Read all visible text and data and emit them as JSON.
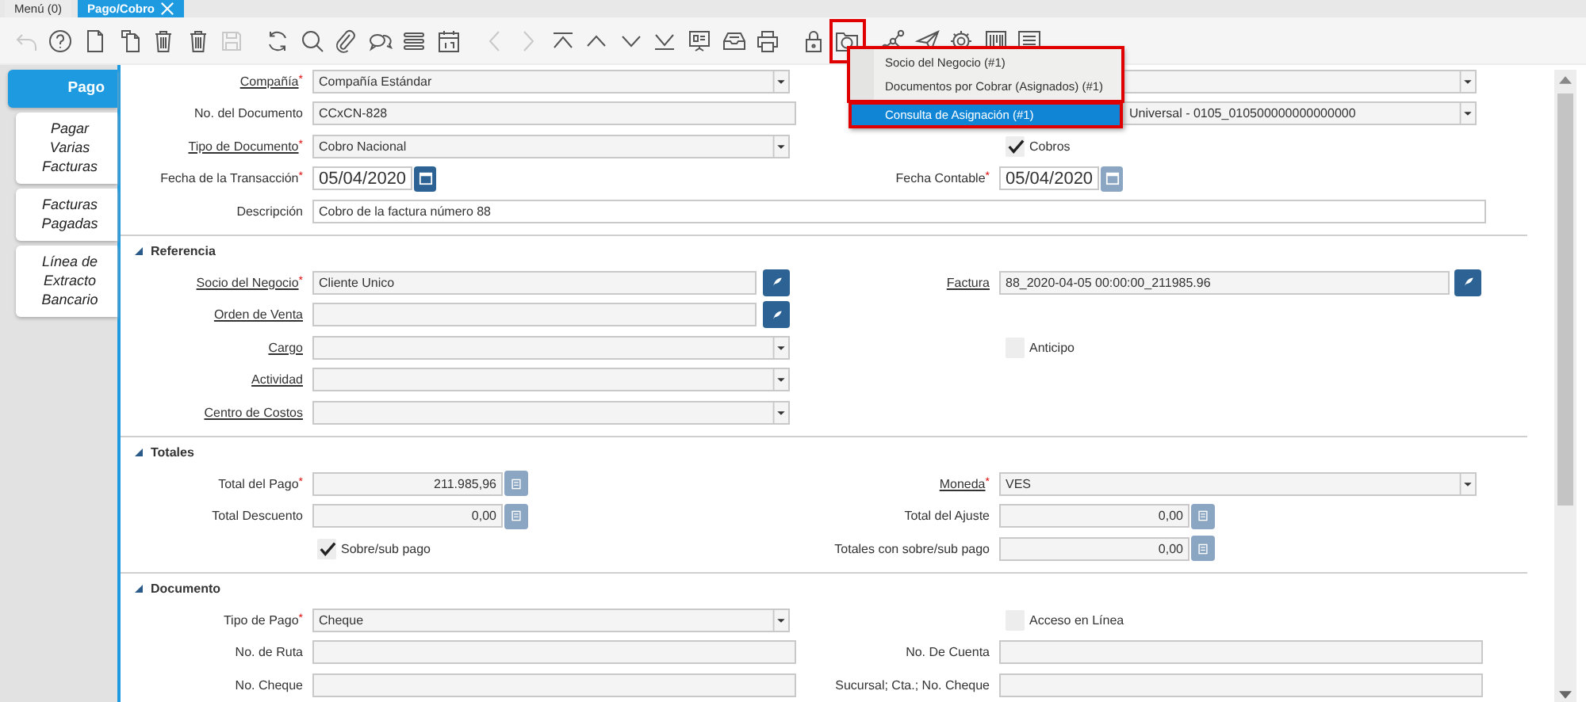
{
  "tabs": [
    {
      "label": "Menú (0)",
      "selected": false,
      "closable": false
    },
    {
      "label": "Pago/Cobro",
      "selected": true,
      "closable": true
    }
  ],
  "toolbar": [
    {
      "kind": "undo",
      "disabled": true,
      "highlighted": false
    },
    {
      "kind": "help",
      "disabled": false,
      "highlighted": false
    },
    {
      "kind": "new",
      "disabled": false,
      "highlighted": false
    },
    {
      "kind": "copy",
      "disabled": false,
      "highlighted": false
    },
    {
      "kind": "delete",
      "disabled": false,
      "highlighted": false
    },
    {
      "kind": "delete",
      "disabled": false,
      "highlighted": false
    },
    {
      "kind": "save",
      "disabled": true,
      "highlighted": false
    },
    {
      "kind": "refresh",
      "disabled": false,
      "highlighted": false
    },
    {
      "kind": "search",
      "disabled": false,
      "highlighted": false
    },
    {
      "kind": "attach",
      "disabled": false,
      "highlighted": false
    },
    {
      "kind": "chat",
      "disabled": false,
      "highlighted": false
    },
    {
      "kind": "list",
      "disabled": false,
      "highlighted": false
    },
    {
      "kind": "calendar",
      "disabled": false,
      "highlighted": false
    },
    {
      "kind": "prev",
      "disabled": true,
      "highlighted": false
    },
    {
      "kind": "next",
      "disabled": true,
      "highlighted": false
    },
    {
      "kind": "first",
      "disabled": false,
      "highlighted": false
    },
    {
      "kind": "up",
      "disabled": false,
      "highlighted": false
    },
    {
      "kind": "down",
      "disabled": false,
      "highlighted": false
    },
    {
      "kind": "last",
      "disabled": false,
      "highlighted": false
    },
    {
      "kind": "report",
      "disabled": false,
      "highlighted": false
    },
    {
      "kind": "archive",
      "disabled": false,
      "highlighted": false
    },
    {
      "kind": "print",
      "disabled": false,
      "highlighted": false
    },
    {
      "kind": "lock",
      "disabled": false,
      "highlighted": false
    },
    {
      "kind": "zoom",
      "disabled": false,
      "highlighted": true
    },
    {
      "kind": "workflow",
      "disabled": false,
      "highlighted": false
    },
    {
      "kind": "send",
      "disabled": false,
      "highlighted": false
    },
    {
      "kind": "gear",
      "disabled": false,
      "highlighted": false
    },
    {
      "kind": "product",
      "disabled": false,
      "highlighted": false
    },
    {
      "kind": "doclist",
      "disabled": false,
      "highlighted": false
    }
  ],
  "side_tabs": [
    {
      "label": "Pago",
      "selected": true
    },
    {
      "label": "Pagar Varias Facturas",
      "selected": false
    },
    {
      "label": "Facturas Pagadas",
      "selected": false
    },
    {
      "label": "Línea de Extracto Bancario",
      "selected": false
    }
  ],
  "sections": [
    {
      "rows": [
        {
          "left": {
            "kind": "select",
            "label": "Compañía",
            "marker": "*",
            "link": true,
            "value": "Compañía Estándar"
          },
          "right": {
            "kind": "select"
          }
        },
        {
          "left": {
            "kind": "text",
            "label": "No. del Documento",
            "link": false,
            "value": "CCxCN-828"
          },
          "right": {
            "kind": "select",
            "covered": true,
            "value": "Universal - 0105_010500000000000000"
          }
        },
        {
          "left": {
            "kind": "select",
            "label": "Tipo de Documento",
            "marker": "*",
            "link": true,
            "value": "Cobro Nacional"
          },
          "right": {
            "kind": "checkbox",
            "label": "Cobros",
            "checked": true
          }
        },
        {
          "left": {
            "kind": "date",
            "label": "Fecha de la Transacción",
            "marker": "*",
            "link": false,
            "value": "05/04/2020",
            "disabled": false
          },
          "right": {
            "kind": "date",
            "label": "Fecha Contable",
            "marker": "*",
            "link": false,
            "value": "05/04/2020",
            "disabled": true
          }
        },
        {
          "full": {
            "kind": "text",
            "label": "Descripción",
            "link": false,
            "value": "Cobro de la factura número 88"
          }
        }
      ]
    },
    {
      "title": "Referencia",
      "expanded": true,
      "rows": [
        {
          "left": {
            "kind": "search",
            "label": "Socio del Negocio",
            "marker": "*",
            "link": true,
            "value": "Cliente Unico",
            "disabled": false
          },
          "right": {
            "kind": "search",
            "label": "Factura",
            "link": true,
            "value": "88_2020-04-05 00:00:00_211985.96",
            "disabled": false
          }
        },
        {
          "left": {
            "kind": "search",
            "label": "Orden de Venta",
            "link": true,
            "disabled": false
          }
        },
        {
          "left": {
            "kind": "select",
            "label": "Cargo",
            "link": true
          },
          "right": {
            "kind": "checkbox",
            "label": "Anticipo",
            "checked": false
          }
        },
        {
          "left": {
            "kind": "select",
            "label": "Actividad",
            "link": true
          }
        },
        {
          "left": {
            "kind": "select",
            "label": "Centro de Costos",
            "link": true
          }
        }
      ]
    },
    {
      "title": "Totales",
      "expanded": true,
      "rows": [
        {
          "left": {
            "kind": "number",
            "label": "Total del Pago",
            "marker": "*",
            "link": false,
            "value": "211.985,96",
            "disabled": true
          },
          "right": {
            "kind": "select",
            "label": "Moneda",
            "marker": "*",
            "link": true,
            "value": "VES"
          }
        },
        {
          "left": {
            "kind": "number",
            "label": "Total Descuento",
            "link": false,
            "value": "0,00",
            "disabled": true
          },
          "right": {
            "kind": "number",
            "label": "Total del Ajuste",
            "link": false,
            "value": "0,00",
            "disabled": true
          }
        },
        {
          "left": {
            "kind": "checkbox",
            "label": "Sobre/sub pago",
            "checked": true
          },
          "right": {
            "kind": "number",
            "label": "Totales con sobre/sub pago",
            "link": false,
            "value": "0,00",
            "disabled": true
          }
        }
      ]
    },
    {
      "title": "Documento",
      "expanded": true,
      "rows": [
        {
          "left": {
            "kind": "select",
            "label": "Tipo de Pago",
            "marker": "*",
            "link": false,
            "value": "Cheque"
          },
          "right": {
            "kind": "checkbox",
            "label": "Acceso en Línea",
            "checked": false
          }
        },
        {
          "left": {
            "kind": "text",
            "label": "No. de Ruta",
            "link": false
          },
          "right": {
            "kind": "text",
            "label": "No. De Cuenta",
            "link": false
          }
        },
        {
          "left": {
            "kind": "text",
            "label": "No. Cheque",
            "link": false
          },
          "right": {
            "kind": "text",
            "label": "Sucursal; Cta.; No. Cheque",
            "link": false
          }
        }
      ]
    }
  ],
  "zoom_menu": {
    "highlighted": true,
    "items": [
      {
        "label": "Socio del Negocio (#1)",
        "selected": false
      },
      {
        "label": "Documentos por Cobrar (Asignados) (#1)",
        "selected": false
      },
      {
        "label": "Consulta de Asignación (#1)",
        "selected": true
      }
    ]
  }
}
